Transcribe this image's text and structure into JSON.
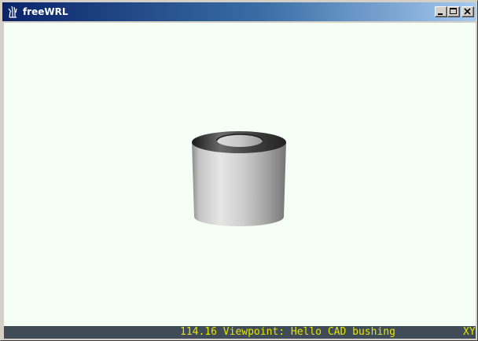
{
  "window": {
    "title": "freeWRL",
    "app_icon": "freewrl-hand-icon",
    "controls": {
      "minimize_icon": "minimize-icon",
      "maximize_icon": "maximize-icon",
      "close_icon": "close-icon"
    }
  },
  "viewport": {
    "background_color": "#f5fff5",
    "scene_object": "cad-bushing"
  },
  "statusbar": {
    "text": "114.16 Viewpoint: Hello CAD bushing",
    "mode": "XY",
    "text_color": "#e6e600",
    "background_color": "#3f4b57"
  }
}
